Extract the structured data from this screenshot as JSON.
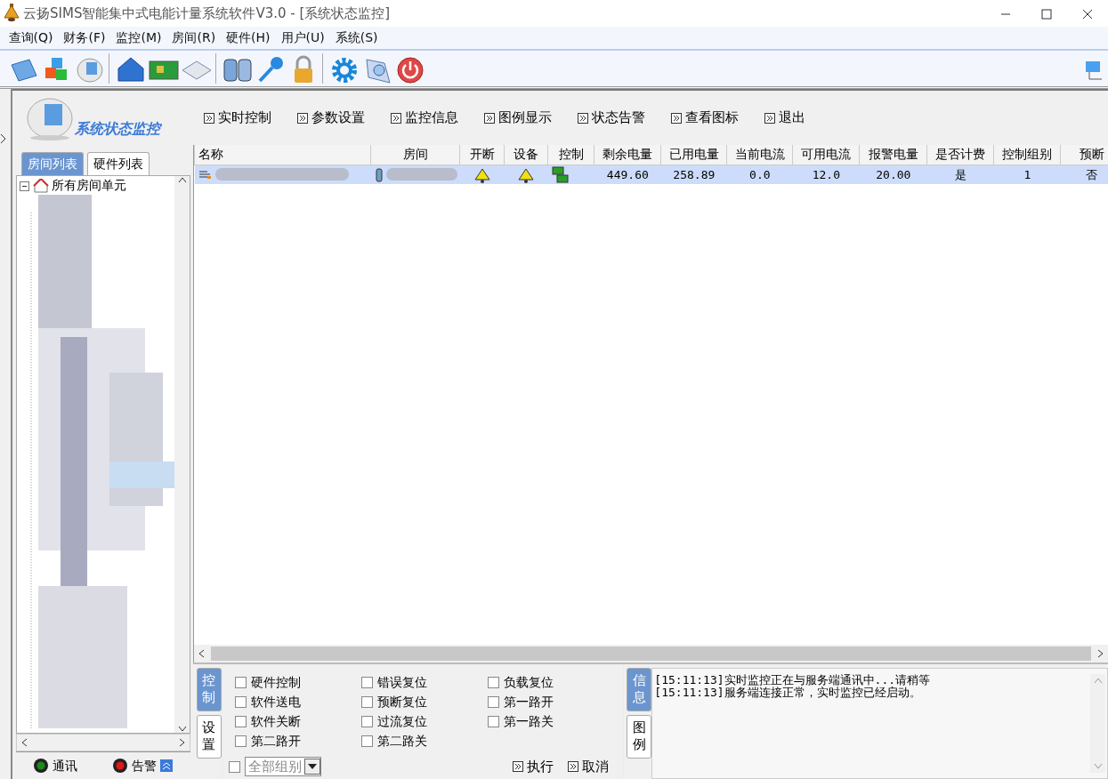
{
  "window": {
    "title": "云扬SIMS智能集中式电能计量系统软件V3.0 - [系统状态监控]"
  },
  "menu": [
    "查询(Q)",
    "财务(F)",
    "监控(M)",
    "房间(R)",
    "硬件(H)",
    "用户(U)",
    "系统(S)"
  ],
  "header": {
    "title": "系统状态监控",
    "actions": [
      "实时控制",
      "参数设置",
      "监控信息",
      "图例显示",
      "状态告警",
      "查看图标",
      "退出"
    ]
  },
  "left_tabs": [
    {
      "label": "房间列表",
      "selected": true
    },
    {
      "label": "硬件列表",
      "selected": false
    }
  ],
  "tree": {
    "root": {
      "label": "所有房间单元",
      "expanded": true
    }
  },
  "table": {
    "columns": [
      "名称",
      "房间",
      "开断",
      "设备",
      "控制",
      "剩余电量",
      "已用电量",
      "当前电流",
      "可用电流",
      "报警电量",
      "是否计费",
      "控制组别",
      "预断"
    ],
    "rows": [
      {
        "selected": true,
        "cells": [
          {
            "kind": "blurred"
          },
          {
            "kind": "blurred"
          },
          {
            "kind": "bell"
          },
          {
            "kind": "bell"
          },
          {
            "kind": "board"
          },
          {
            "kind": "text",
            "text": "449.60"
          },
          {
            "kind": "text",
            "text": "258.89"
          },
          {
            "kind": "text",
            "text": "0.0"
          },
          {
            "kind": "text",
            "text": "12.0"
          },
          {
            "kind": "text",
            "text": "20.00"
          },
          {
            "kind": "text",
            "text": "是"
          },
          {
            "kind": "text",
            "text": "1"
          },
          {
            "kind": "text",
            "text": "否"
          }
        ]
      }
    ]
  },
  "control_tabs": [
    {
      "label": "控制",
      "selected": true
    },
    {
      "label": "设置",
      "selected": false
    }
  ],
  "checkboxes": [
    {
      "label": "硬件控制",
      "checked": false
    },
    {
      "label": "错误复位",
      "checked": false
    },
    {
      "label": "负载复位",
      "checked": false
    },
    {
      "label": "软件送电",
      "checked": false
    },
    {
      "label": "预断复位",
      "checked": false
    },
    {
      "label": "第一路开",
      "checked": false
    },
    {
      "label": "软件关断",
      "checked": false
    },
    {
      "label": "过流复位",
      "checked": false
    },
    {
      "label": "第一路关",
      "checked": false
    },
    {
      "label": "第二路开",
      "checked": false
    },
    {
      "label": "第二路关",
      "checked": false
    }
  ],
  "group_filter": {
    "checked": false,
    "value": "全部组别"
  },
  "buttons": [
    "执行",
    "取消"
  ],
  "info_tabs": [
    {
      "label": "信息",
      "selected": true
    },
    {
      "label": "图例",
      "selected": false
    }
  ],
  "log": [
    "[15:11:13]实时监控正在与服务端通讯中...请稍等",
    "[15:11:13]服务端连接正常，实时监控已经启动。"
  ],
  "status": [
    {
      "label": "通讯",
      "kind": "ok"
    },
    {
      "label": "告警",
      "kind": "alarm"
    }
  ]
}
